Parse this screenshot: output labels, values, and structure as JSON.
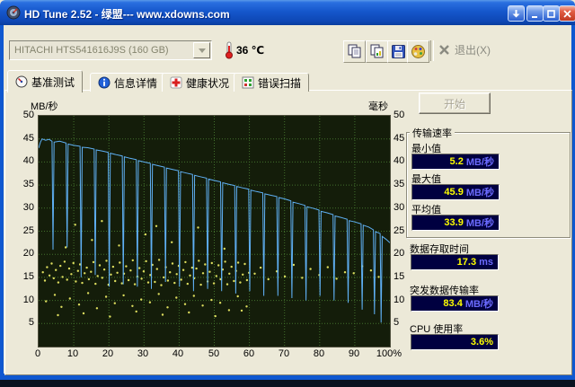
{
  "window": {
    "title": "HD Tune 2.52 - 绿盟--- www.xdowns.com"
  },
  "toolbar": {
    "device": "HITACHI HTS541616J9S (160 GB)",
    "temperature": "36 ℃",
    "exit_label": "退出(X)"
  },
  "tabs": [
    {
      "label": "基准测试"
    },
    {
      "label": "信息详情"
    },
    {
      "label": "健康状况"
    },
    {
      "label": "错误扫描"
    }
  ],
  "panel": {
    "start_label": "开始",
    "transfer_group": {
      "title": "传输速率",
      "min_label": "最小值",
      "min_value": "5.2",
      "min_unit": "MB/秒",
      "max_label": "最大值",
      "max_value": "45.9",
      "max_unit": "MB/秒",
      "avg_label": "平均值",
      "avg_value": "33.9",
      "avg_unit": "MB/秒"
    },
    "access_label": "数据存取时间",
    "access_value": "17.3",
    "access_unit": "ms",
    "burst_label": "突发数据传输率",
    "burst_value": "83.4",
    "burst_unit": "MB/秒",
    "cpu_label": "CPU 使用率",
    "cpu_value": "3.6%"
  },
  "chart_data": {
    "type": "line+scatter",
    "ylabel_left": "MB/秒",
    "ylabel_right": "毫秒",
    "ylim": [
      0,
      50
    ],
    "yticks": [
      50,
      45,
      40,
      35,
      30,
      25,
      20,
      15,
      10,
      5
    ],
    "xticks": [
      "0",
      "10",
      "20",
      "30",
      "40",
      "50",
      "60",
      "70",
      "80",
      "90",
      "100%"
    ],
    "grid": true,
    "plot_bg": "#141d0a",
    "results": {
      "min_mb_s": 5.2,
      "max_mb_s": 45.9,
      "avg_mb_s": 33.9,
      "access_ms": 17.3,
      "burst_mb_s": 83.4,
      "cpu_pct": 3.6
    },
    "series": [
      {
        "name": "transfer_rate_mb_s",
        "type": "line",
        "color": "#5fb0f5",
        "points": [
          [
            0,
            43
          ],
          [
            0.5,
            44.3
          ],
          [
            1,
            45
          ],
          [
            2,
            44.7
          ],
          [
            3,
            44.9
          ],
          [
            3.8,
            44.5
          ],
          [
            4.1,
            21
          ],
          [
            4.4,
            44.3
          ],
          [
            6,
            44.5
          ],
          [
            7.8,
            44.1
          ],
          [
            8.1,
            21.5
          ],
          [
            8.4,
            43.9
          ],
          [
            10,
            43.6
          ],
          [
            11.8,
            43.4
          ],
          [
            12.1,
            15
          ],
          [
            12.4,
            43.2
          ],
          [
            14,
            43.1
          ],
          [
            15.8,
            42.8
          ],
          [
            16.1,
            15.5
          ],
          [
            16.4,
            42.6
          ],
          [
            18,
            42.4
          ],
          [
            19.8,
            42.1
          ],
          [
            20.1,
            13
          ],
          [
            20.4,
            41.9
          ],
          [
            22,
            41.6
          ],
          [
            23.8,
            41.3
          ],
          [
            24.1,
            13.5
          ],
          [
            24.4,
            41.1
          ],
          [
            26,
            40.8
          ],
          [
            27.8,
            40.5
          ],
          [
            28.1,
            13
          ],
          [
            28.4,
            40.3
          ],
          [
            30,
            40
          ],
          [
            31.8,
            39.7
          ],
          [
            32.1,
            12.5
          ],
          [
            32.4,
            39.5
          ],
          [
            34,
            39.2
          ],
          [
            35.8,
            38.9
          ],
          [
            36.1,
            14
          ],
          [
            36.4,
            38.7
          ],
          [
            38,
            38.4
          ],
          [
            39.8,
            38.1
          ],
          [
            40.1,
            13
          ],
          [
            40.4,
            37.9
          ],
          [
            42,
            37.6
          ],
          [
            43.8,
            37.3
          ],
          [
            44.1,
            12
          ],
          [
            44.4,
            37.1
          ],
          [
            46,
            36.8
          ],
          [
            47.8,
            36.5
          ],
          [
            48.1,
            12.5
          ],
          [
            48.4,
            36.3
          ],
          [
            50,
            36
          ],
          [
            51.8,
            35.7
          ],
          [
            52.1,
            12
          ],
          [
            52.4,
            35.5
          ],
          [
            54,
            35.2
          ],
          [
            55.8,
            34.9
          ],
          [
            56.1,
            11.5
          ],
          [
            56.4,
            34.7
          ],
          [
            58,
            34.4
          ],
          [
            59.8,
            34.1
          ],
          [
            60.1,
            12
          ],
          [
            60.4,
            33.9
          ],
          [
            62,
            33.6
          ],
          [
            63.8,
            33.3
          ],
          [
            64.1,
            11
          ],
          [
            64.4,
            33.1
          ],
          [
            66,
            32.8
          ],
          [
            67.8,
            32.5
          ],
          [
            68.1,
            11
          ],
          [
            68.4,
            32.3
          ],
          [
            70,
            32
          ],
          [
            71.8,
            31.6
          ],
          [
            72.1,
            10.5
          ],
          [
            72.4,
            31.3
          ],
          [
            74,
            31
          ],
          [
            75.8,
            30.6
          ],
          [
            76.1,
            10
          ],
          [
            76.4,
            30.3
          ],
          [
            78,
            30
          ],
          [
            79.8,
            29.6
          ],
          [
            80.1,
            11
          ],
          [
            80.4,
            29.3
          ],
          [
            82,
            29
          ],
          [
            83.8,
            28.6
          ],
          [
            84.1,
            10
          ],
          [
            84.4,
            28.3
          ],
          [
            86,
            28
          ],
          [
            87.8,
            27.6
          ],
          [
            88.1,
            9.5
          ],
          [
            88.4,
            27.3
          ],
          [
            90,
            27
          ],
          [
            91.8,
            26.6
          ],
          [
            92.1,
            8
          ],
          [
            92.4,
            26.3
          ],
          [
            94,
            25.9
          ],
          [
            95.3,
            25.3
          ],
          [
            95.6,
            7
          ],
          [
            95.9,
            24.9
          ],
          [
            97.2,
            24.5
          ],
          [
            97.5,
            5.2
          ],
          [
            97.8,
            23.9
          ],
          [
            99,
            23.2
          ],
          [
            100,
            22.5
          ]
        ]
      },
      {
        "name": "access_time_ms",
        "type": "scatter",
        "color": "#dede5e",
        "points": [
          [
            1.2,
            16.1
          ],
          [
            1.8,
            14.3
          ],
          [
            2.4,
            17.2
          ],
          [
            3.1,
            15.4
          ],
          [
            3.7,
            18
          ],
          [
            4.3,
            14.8
          ],
          [
            4.9,
            16.6
          ],
          [
            5.6,
            13.9
          ],
          [
            6.2,
            17.5
          ],
          [
            6.8,
            15.1
          ],
          [
            7.4,
            18.4
          ],
          [
            8.1,
            14.5
          ],
          [
            8.7,
            16.9
          ],
          [
            9.3,
            15.7
          ],
          [
            9.9,
            18.1
          ],
          [
            10.6,
            14.1
          ],
          [
            11.2,
            16.4
          ],
          [
            11.8,
            17.8
          ],
          [
            12.4,
            13.8
          ],
          [
            13.1,
            15.9
          ],
          [
            13.7,
            17.1
          ],
          [
            14.3,
            14.6
          ],
          [
            14.9,
            16.2
          ],
          [
            15.6,
            18.3
          ],
          [
            16.2,
            13.6
          ],
          [
            16.8,
            15.3
          ],
          [
            17.4,
            17.6
          ],
          [
            18.1,
            14.9
          ],
          [
            18.7,
            16.7
          ],
          [
            19.3,
            18.6
          ],
          [
            19.9,
            13.4
          ],
          [
            20.6,
            15.6
          ],
          [
            21.2,
            17.3
          ],
          [
            21.8,
            14.2
          ],
          [
            22.4,
            16
          ],
          [
            23.1,
            18.2
          ],
          [
            23.7,
            13.7
          ],
          [
            24.3,
            15.8
          ],
          [
            24.9,
            17.4
          ],
          [
            25.6,
            14.4
          ],
          [
            26.2,
            16.5
          ],
          [
            26.8,
            18.7
          ],
          [
            27.4,
            13.5
          ],
          [
            28.1,
            15.2
          ],
          [
            28.7,
            17
          ],
          [
            29.3,
            14.7
          ],
          [
            29.9,
            16.3
          ],
          [
            30.6,
            18.5
          ],
          [
            31.2,
            13.9
          ],
          [
            31.8,
            15.5
          ],
          [
            32.4,
            17.7
          ],
          [
            33.1,
            14
          ],
          [
            33.7,
            16.8
          ],
          [
            34.3,
            18.8
          ],
          [
            34.9,
            13.3
          ],
          [
            35.6,
            15
          ],
          [
            36.2,
            17.2
          ],
          [
            36.8,
            14.3
          ],
          [
            37.4,
            16.1
          ],
          [
            38.1,
            18
          ],
          [
            38.7,
            13.8
          ],
          [
            39.3,
            15.7
          ],
          [
            39.9,
            17.5
          ],
          [
            40.6,
            14.5
          ],
          [
            41.2,
            16.6
          ],
          [
            41.8,
            18.3
          ],
          [
            42.4,
            13.6
          ],
          [
            43.1,
            15.4
          ],
          [
            43.7,
            17.1
          ],
          [
            44.3,
            14.8
          ],
          [
            44.9,
            16.9
          ],
          [
            45.6,
            18.6
          ],
          [
            46.2,
            13.4
          ],
          [
            46.8,
            15.9
          ],
          [
            47.4,
            17.8
          ],
          [
            48.1,
            14.1
          ],
          [
            48.7,
            16.2
          ],
          [
            49.3,
            18.1
          ],
          [
            49.9,
            13.7
          ],
          [
            50.6,
            15.3
          ],
          [
            51.2,
            17.6
          ],
          [
            51.8,
            14.6
          ],
          [
            52.4,
            16.7
          ],
          [
            53.1,
            18.4
          ],
          [
            53.7,
            13.5
          ],
          [
            54.3,
            15.8
          ],
          [
            54.9,
            17.3
          ],
          [
            55.6,
            14.2
          ],
          [
            56.2,
            16.4
          ],
          [
            56.8,
            18.2
          ],
          [
            57.4,
            13.9
          ],
          [
            58.1,
            15.6
          ],
          [
            58.7,
            17.9
          ],
          [
            59.3,
            14.4
          ],
          [
            59.9,
            16
          ],
          [
            2.1,
            9.8
          ],
          [
            4.6,
            11.2
          ],
          [
            6.5,
            8.6
          ],
          [
            8.9,
            10.4
          ],
          [
            11.5,
            9.1
          ],
          [
            14.1,
            11.6
          ],
          [
            16.6,
            8.3
          ],
          [
            19.2,
            10.8
          ],
          [
            21.7,
            9.4
          ],
          [
            24.2,
            11.1
          ],
          [
            26.7,
            8.8
          ],
          [
            29.2,
            10.2
          ],
          [
            31.7,
            9.6
          ],
          [
            34.2,
            11.4
          ],
          [
            36.7,
            8.5
          ],
          [
            39.2,
            10.6
          ],
          [
            41.7,
            9.2
          ],
          [
            44.2,
            11
          ],
          [
            46.7,
            8.9
          ],
          [
            49.2,
            10.1
          ],
          [
            51.7,
            9.5
          ],
          [
            54.2,
            7.9
          ],
          [
            56.7,
            10.9
          ],
          [
            59.2,
            8.7
          ],
          [
            5.5,
            6.8
          ],
          [
            12.8,
            7.2
          ],
          [
            20.3,
            6.5
          ],
          [
            27.8,
            7.6
          ],
          [
            35.3,
            6.9
          ],
          [
            42.8,
            7.4
          ],
          [
            50.3,
            6.6
          ],
          [
            57.8,
            7.8
          ],
          [
            61.5,
            15.8
          ],
          [
            63.2,
            17.1
          ],
          [
            65.4,
            14.6
          ],
          [
            67.8,
            16.3
          ],
          [
            70.1,
            15.2
          ],
          [
            72.6,
            17.7
          ],
          [
            75,
            14.9
          ],
          [
            77.4,
            16.8
          ],
          [
            79.9,
            15.5
          ],
          [
            82.3,
            17.2
          ],
          [
            84.8,
            14.7
          ],
          [
            87.2,
            16.1
          ],
          [
            89.7,
            15.9
          ],
          [
            92.1,
            17.4
          ],
          [
            94.6,
            16.5
          ],
          [
            96.8,
            15.1
          ],
          [
            7.7,
            21.5
          ],
          [
            15.2,
            23.1
          ],
          [
            22.9,
            21.9
          ],
          [
            30.4,
            24.3
          ],
          [
            37.9,
            22.6
          ],
          [
            45.4,
            25.8
          ],
          [
            52.9,
            21.2
          ],
          [
            10.4,
            26.4
          ],
          [
            18,
            27.2
          ],
          [
            33.5,
            26.1
          ]
        ]
      }
    ]
  }
}
